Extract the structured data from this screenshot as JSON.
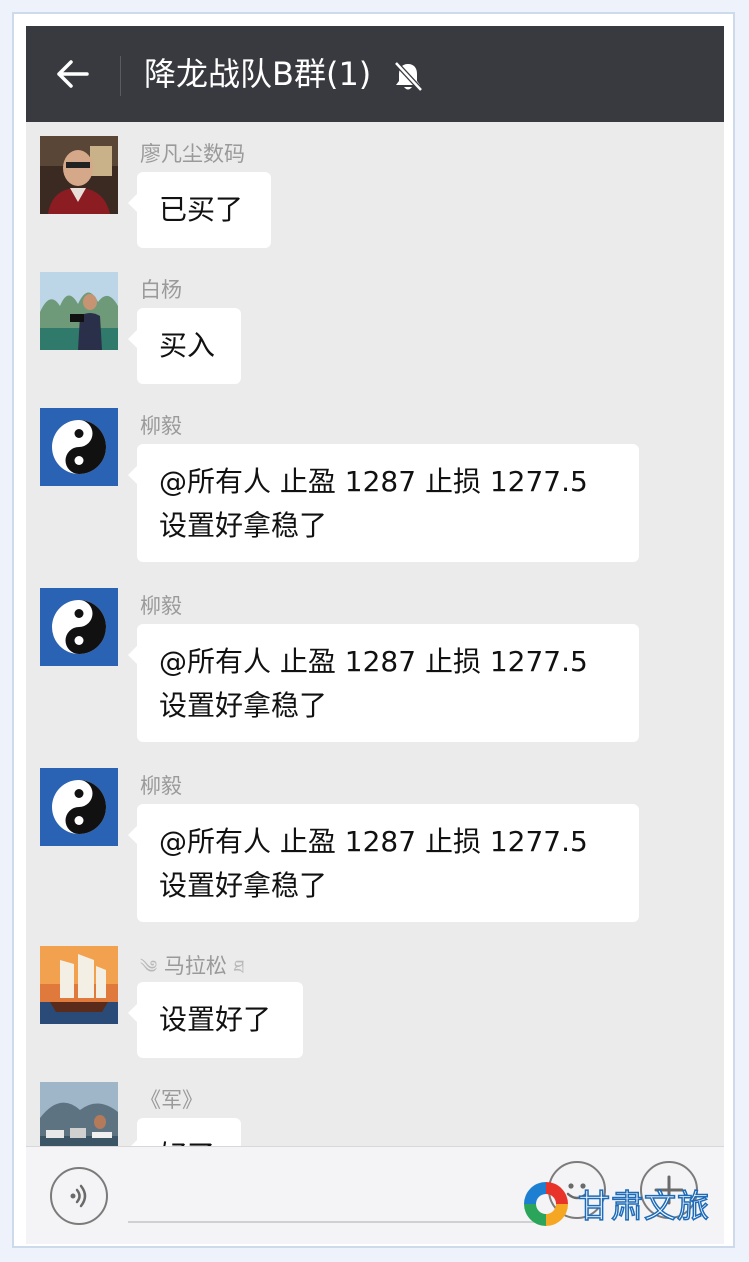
{
  "header": {
    "title": "降龙战队B群(1)",
    "back_icon": "arrow-left-icon",
    "mute_icon": "bell-muted-icon"
  },
  "messages": [
    {
      "sender": "廖凡尘数码",
      "text": "已买了",
      "avatar": "portrait-man-red-jacket"
    },
    {
      "sender": "白杨",
      "text": "买入",
      "avatar": "man-with-camera-landscape"
    },
    {
      "sender": "柳毅",
      "text": "@所有人 止盈 1287 止损 1277.5 设置好拿稳了",
      "avatar": "yin-yang"
    },
    {
      "sender": "柳毅",
      "text": "@所有人 止盈 1287 止损 1277.5 设置好拿稳了",
      "avatar": "yin-yang"
    },
    {
      "sender": "柳毅",
      "text": "@所有人 止盈 1287 止损 1277.5 设置好拿稳了",
      "avatar": "yin-yang"
    },
    {
      "sender": "马拉松",
      "text": "设置好了",
      "avatar": "sailing-ship"
    },
    {
      "sender": "《军》",
      "text": "好了",
      "avatar": "harbor-boats"
    }
  ],
  "bottombar": {
    "voice_icon": "voice-icon",
    "emoji_icon": "emoji-icon",
    "plus_icon": "plus-icon"
  },
  "watermark": {
    "text": "甘肃文旅",
    "logo": "gansu-culture-tourism-logo"
  },
  "colors": {
    "topbar": "#393a3f",
    "chat_bg": "#ebebeb",
    "bubble": "#ffffff",
    "sender": "#9a9a9a"
  }
}
